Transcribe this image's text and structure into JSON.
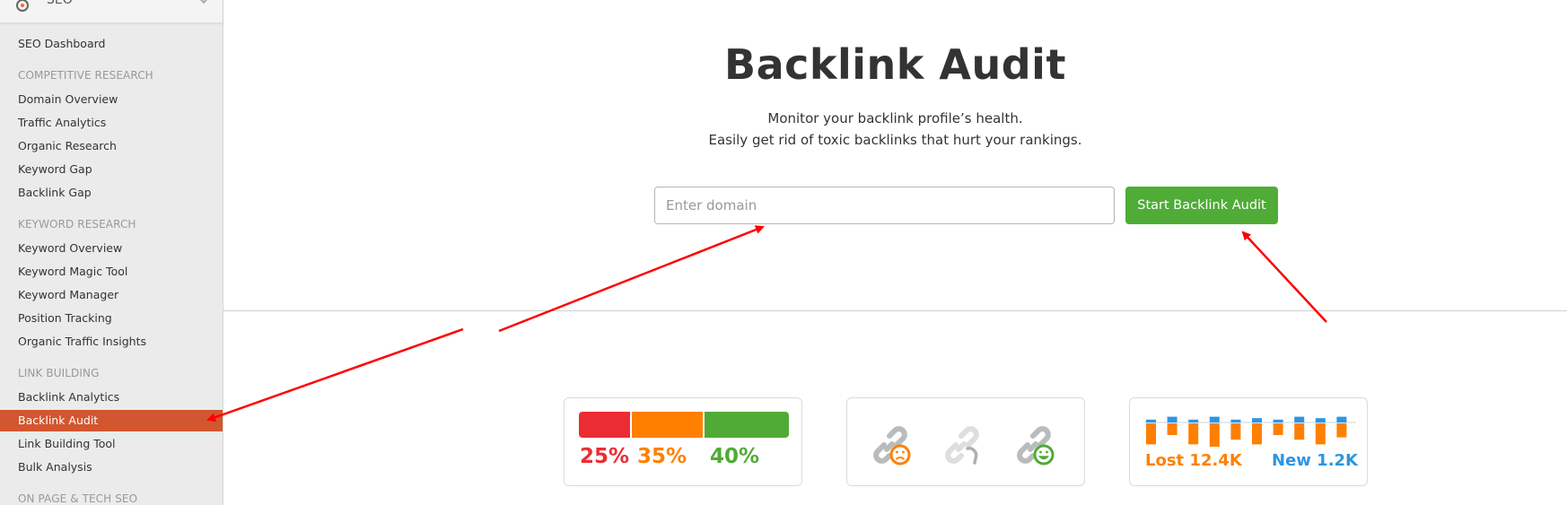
{
  "sidebar": {
    "header": {
      "label": "SEO",
      "icon": "target-icon"
    },
    "items": [
      {
        "type": "item",
        "label": "SEO Dashboard"
      },
      {
        "type": "section",
        "label": "COMPETITIVE RESEARCH"
      },
      {
        "type": "item",
        "label": "Domain Overview"
      },
      {
        "type": "item",
        "label": "Traffic Analytics"
      },
      {
        "type": "item",
        "label": "Organic Research"
      },
      {
        "type": "item",
        "label": "Keyword Gap"
      },
      {
        "type": "item",
        "label": "Backlink Gap"
      },
      {
        "type": "section",
        "label": "KEYWORD RESEARCH"
      },
      {
        "type": "item",
        "label": "Keyword Overview"
      },
      {
        "type": "item",
        "label": "Keyword Magic Tool"
      },
      {
        "type": "item",
        "label": "Keyword Manager"
      },
      {
        "type": "item",
        "label": "Position Tracking"
      },
      {
        "type": "item",
        "label": "Organic Traffic Insights"
      },
      {
        "type": "section",
        "label": "LINK BUILDING"
      },
      {
        "type": "item",
        "label": "Backlink Analytics"
      },
      {
        "type": "item",
        "label": "Backlink Audit",
        "active": true
      },
      {
        "type": "item",
        "label": "Link Building Tool"
      },
      {
        "type": "item",
        "label": "Bulk Analysis"
      },
      {
        "type": "section",
        "label": "ON PAGE & TECH SEO"
      }
    ]
  },
  "main": {
    "title": "Backlink Audit",
    "subtitle_line1": "Monitor your backlink profile’s health.",
    "subtitle_line2": "Easily get rid of toxic backlinks that hurt your rankings.",
    "domain_input": {
      "value": "",
      "placeholder": "Enter domain"
    },
    "start_button": "Start Backlink Audit"
  },
  "cards": {
    "toxicity": {
      "segments": [
        {
          "label": "25%",
          "percent": 25,
          "color": "#ec2c33"
        },
        {
          "label": "35%",
          "percent": 35,
          "color": "#ff8000"
        },
        {
          "label": "40%",
          "percent": 40,
          "color": "#50ab36"
        }
      ]
    },
    "link_status": {
      "icons": [
        "toxic-link-icon",
        "broken-link-icon",
        "healthy-link-icon"
      ],
      "colors": {
        "link": "#b9bcbd",
        "link_light": "#dcdedf",
        "bad": "#ff8000",
        "good": "#50ab36",
        "broken": "#b0b0b0"
      }
    },
    "lost_new": {
      "lost_label": "Lost 12.4K",
      "new_label": "New 1.2K",
      "lost_color": "#ff8000",
      "new_color": "#2d95e2",
      "bars": [
        {
          "new": 2,
          "lost": 9
        },
        {
          "new": 4,
          "lost": 5
        },
        {
          "new": 2,
          "lost": 9
        },
        {
          "new": 4,
          "lost": 10
        },
        {
          "new": 2,
          "lost": 7
        },
        {
          "new": 3,
          "lost": 9
        },
        {
          "new": 2,
          "lost": 5
        },
        {
          "new": 4,
          "lost": 7
        },
        {
          "new": 3,
          "lost": 9
        },
        {
          "new": 4,
          "lost": 6
        }
      ]
    }
  },
  "annotations": {
    "arrow_color": "#ff0000"
  }
}
